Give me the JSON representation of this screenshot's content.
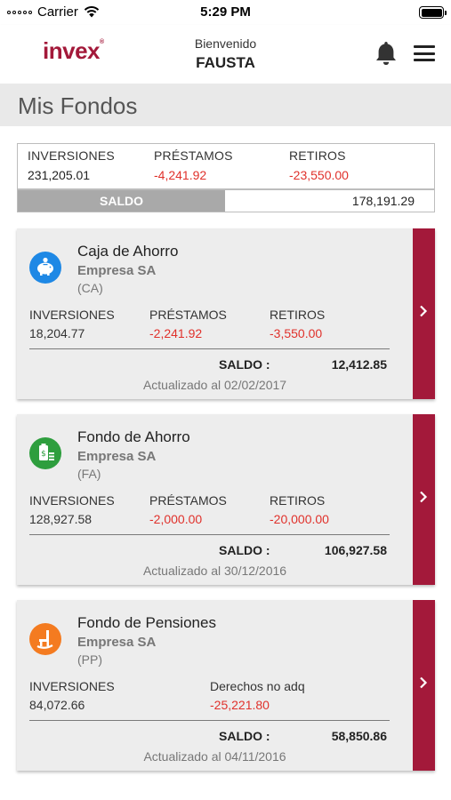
{
  "status_bar": {
    "carrier": "Carrier",
    "time": "5:29 PM"
  },
  "header": {
    "logo": "invex",
    "logo_mark": "®",
    "welcome": "Bienvenido",
    "user": "FAUSTA"
  },
  "page": {
    "title": "Mis Fondos"
  },
  "summary": {
    "inversiones_label": "INVERSIONES",
    "inversiones_value": "231,205.01",
    "prestamos_label": "PRÉSTAMOS",
    "prestamos_value": "-4,241.92",
    "retiros_label": "RETIROS",
    "retiros_value": "-23,550.00",
    "saldo_label": "SALDO",
    "saldo_value": "178,191.29"
  },
  "funds": [
    {
      "name": "Caja de Ahorro",
      "company": "Empresa SA",
      "code": "(CA)",
      "icon": "piggy-bank-icon",
      "icon_color": "#1e88e5",
      "col1_label": "INVERSIONES",
      "col1_value": "18,204.77",
      "col2_label": "PRÉSTAMOS",
      "col2_value": "-2,241.92",
      "col3_label": "RETIROS",
      "col3_value": "-3,550.00",
      "saldo_label": "SALDO :",
      "saldo_value": "12,412.85",
      "updated": "Actualizado al 02/02/2017"
    },
    {
      "name": "Fondo de Ahorro",
      "company": "Empresa SA",
      "code": "(FA)",
      "icon": "money-stack-icon",
      "icon_color": "#2e9e3e",
      "col1_label": "INVERSIONES",
      "col1_value": "128,927.58",
      "col2_label": "PRÉSTAMOS",
      "col2_value": "-2,000.00",
      "col3_label": "RETIROS",
      "col3_value": "-20,000.00",
      "saldo_label": "SALDO :",
      "saldo_value": "106,927.58",
      "updated": "Actualizado al 30/12/2016"
    },
    {
      "name": "Fondo de Pensiones",
      "company": "Empresa SA",
      "code": "(PP)",
      "icon": "rocking-chair-icon",
      "icon_color": "#f47b20",
      "col1_label": "INVERSIONES",
      "col1_value": "84,072.66",
      "col2_label": "Derechos no adq",
      "col2_value": "-25,221.80",
      "saldo_label": "SALDO :",
      "saldo_value": "58,850.86",
      "updated": "Actualizado al 04/11/2016"
    }
  ],
  "colors": {
    "brand": "#a3193a",
    "negative": "#e0312b"
  }
}
